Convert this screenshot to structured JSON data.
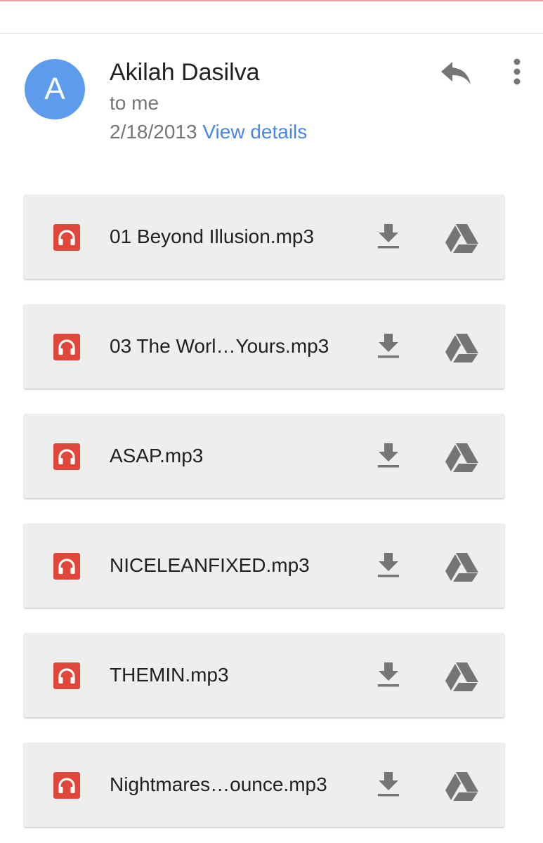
{
  "message": {
    "avatar_letter": "A",
    "sender": "Akilah Dasilva",
    "recipient": "to me",
    "date": "2/18/2013",
    "view_details_label": "View details"
  },
  "icons": {
    "reply": "reply-icon",
    "more": "more-vert-icon",
    "audio": "headphones-icon",
    "download": "download-icon",
    "drive": "google-drive-icon"
  },
  "colors": {
    "avatar": "#5d9cec",
    "link": "#4a86e8",
    "audio_icon": "#e0463a",
    "action_icon": "#757575",
    "card_background": "#eeeeee"
  },
  "attachments": [
    {
      "name": "01 Beyond Illusion.mp3"
    },
    {
      "name": "03 The Worl…Yours.mp3"
    },
    {
      "name": "ASAP.mp3"
    },
    {
      "name": "NICELEANFIXED.mp3"
    },
    {
      "name": "THEMIN.mp3"
    },
    {
      "name": "Nightmares…ounce.mp3"
    }
  ]
}
